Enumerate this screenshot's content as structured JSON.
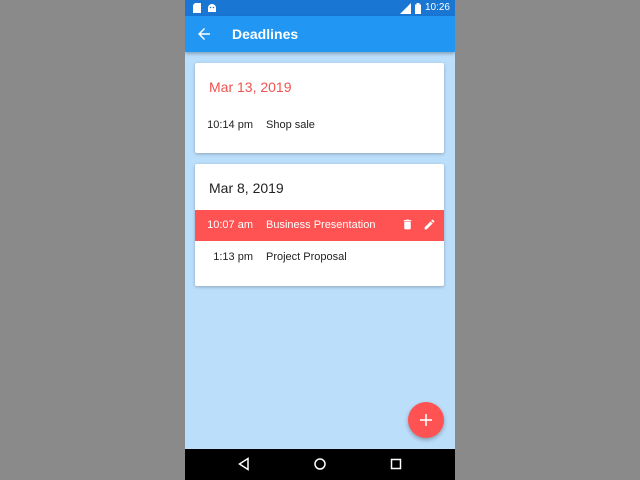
{
  "status_bar": {
    "time": "10:26",
    "icons": [
      "sd-card-icon",
      "android-icon",
      "signal-icon",
      "battery-icon"
    ]
  },
  "app_bar": {
    "title": "Deadlines",
    "back_icon": "arrow-back-icon"
  },
  "groups": [
    {
      "date": "Mar 13, 2019",
      "highlight_color": "#ef5350",
      "items": [
        {
          "time": "10:14 pm",
          "title": "Shop sale",
          "selected": false
        }
      ]
    },
    {
      "date": "Mar 8, 2019",
      "items": [
        {
          "time": "10:07 am",
          "title": "Business Presentation",
          "selected": true,
          "actions": [
            "delete-icon",
            "edit-icon"
          ]
        },
        {
          "time": "1:13 pm",
          "title": "Project Proposal",
          "selected": false
        }
      ]
    }
  ],
  "fab": {
    "icon": "plus-icon"
  },
  "nav_bar": {
    "buttons": [
      "back-triangle-icon",
      "home-circle-icon",
      "recents-square-icon"
    ]
  },
  "colors": {
    "primary": "#2196f3",
    "primary_dark": "#1976d2",
    "accent": "#ff5252",
    "background": "#bbdefb"
  }
}
